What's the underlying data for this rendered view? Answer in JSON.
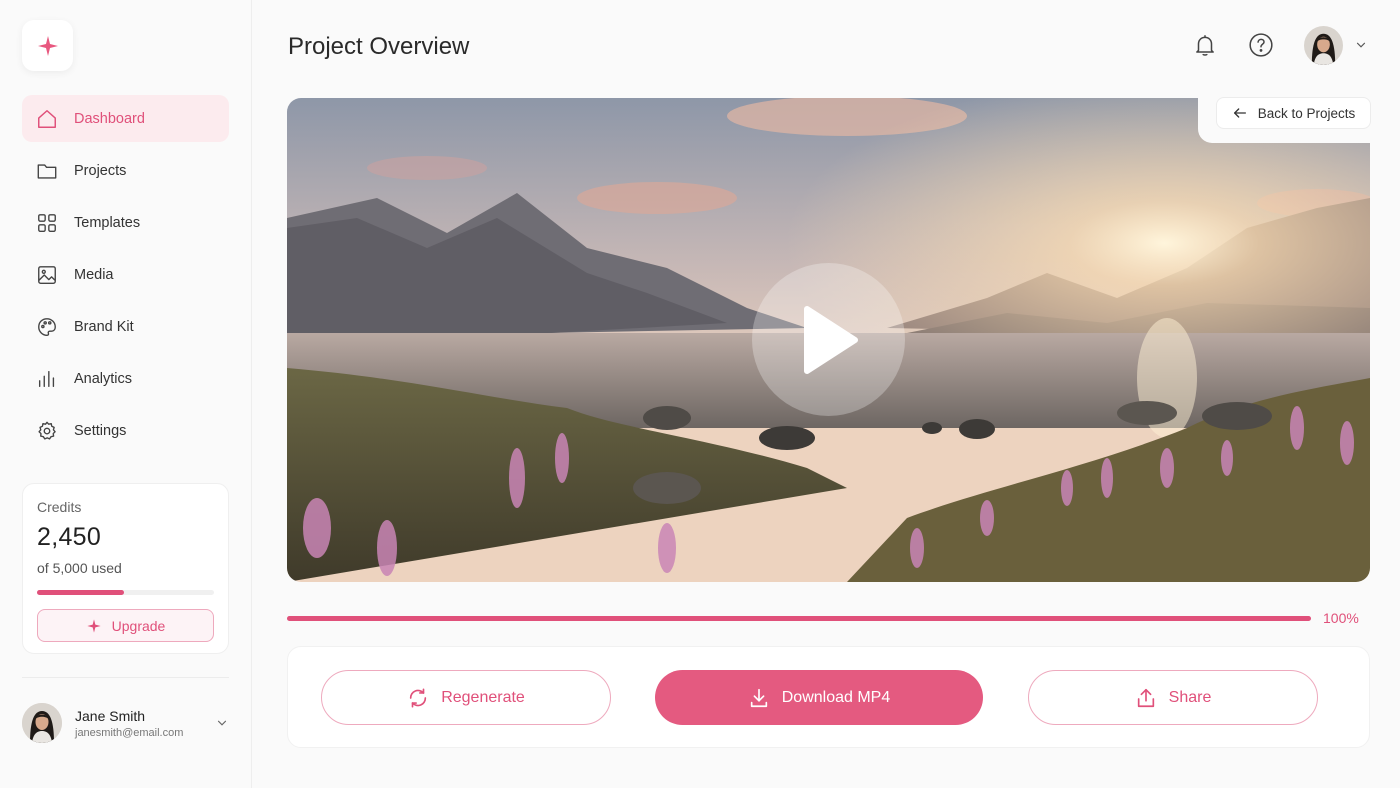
{
  "sidebar": {
    "logo_icon": "sparkle-icon",
    "items": [
      {
        "label": "Dashboard",
        "icon": "home-icon",
        "active": true
      },
      {
        "label": "Projects",
        "icon": "folder-icon"
      },
      {
        "label": "Templates",
        "icon": "grid-icon"
      },
      {
        "label": "Media",
        "icon": "image-icon"
      },
      {
        "label": "Brand Kit",
        "icon": "palette-icon"
      },
      {
        "label": "Analytics",
        "icon": "bar-chart-icon"
      },
      {
        "label": "Settings",
        "icon": "gear-icon"
      }
    ],
    "credits": {
      "label": "Credits",
      "value": "2,450",
      "used_text": "of 5,000 used",
      "used_fraction": 0.49,
      "upgrade_label": "Upgrade"
    },
    "user": {
      "name": "Jane Smith",
      "email": "janesmith@email.com"
    }
  },
  "header": {
    "title": "Project Overview",
    "icons": [
      "bell-icon",
      "help-icon",
      "avatar",
      "chevron-down-icon"
    ]
  },
  "video": {
    "back_label": "Back to Projects",
    "progress_percent": 100,
    "progress_label": "100%"
  },
  "actions": {
    "regenerate_label": "Regenerate",
    "download_label": "Download MP4",
    "share_label": "Share"
  },
  "colors": {
    "accent": "#e0507a",
    "accent_light": "#fcebee"
  }
}
